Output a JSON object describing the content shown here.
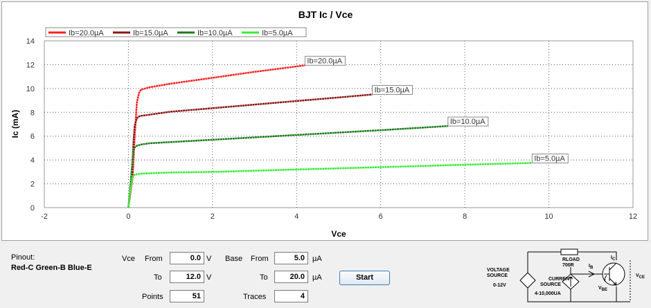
{
  "chart_data": {
    "type": "line",
    "title": "BJT Ic / Vce",
    "xlabel": "Vce",
    "ylabel": "Ic (mA)",
    "xlim": [
      -2,
      12
    ],
    "ylim": [
      0,
      14
    ],
    "xticks": [
      "-2",
      "0",
      "2",
      "4",
      "6",
      "8",
      "10",
      "12"
    ],
    "yticks": [
      "0",
      "2",
      "4",
      "6",
      "8",
      "10",
      "12",
      "14"
    ],
    "grid": true,
    "legend_position": "top-left",
    "series": [
      {
        "name": "Ib=20.0µA",
        "color": "#ff2020",
        "x": [
          0,
          0.1,
          0.15,
          0.2,
          0.25,
          0.3,
          0.5,
          1,
          2,
          3,
          4,
          4.2
        ],
        "y": [
          0,
          2.5,
          6,
          8.8,
          9.6,
          9.9,
          10.1,
          10.4,
          10.9,
          11.4,
          11.85,
          11.95
        ]
      },
      {
        "name": "Ib=15.0µA",
        "color": "#8b1414",
        "x": [
          0,
          0.08,
          0.12,
          0.15,
          0.2,
          0.25,
          0.3,
          0.5,
          1,
          2,
          3,
          4,
          5,
          5.8
        ],
        "y": [
          0,
          2.5,
          5.5,
          6.9,
          7.5,
          7.65,
          7.7,
          7.8,
          8.05,
          8.35,
          8.65,
          8.95,
          9.25,
          9.5
        ]
      },
      {
        "name": "Ib=10.0µA",
        "color": "#1a7a1a",
        "x": [
          0,
          0.06,
          0.1,
          0.12,
          0.15,
          0.2,
          0.3,
          0.5,
          1,
          2,
          4,
          6,
          7.6
        ],
        "y": [
          0,
          2.4,
          4.1,
          4.8,
          5.05,
          5.2,
          5.3,
          5.4,
          5.5,
          5.7,
          6.1,
          6.5,
          6.85
        ]
      },
      {
        "name": "Ib=5.0µA",
        "color": "#33ee33",
        "x": [
          0,
          0.05,
          0.08,
          0.1,
          0.15,
          0.2,
          0.3,
          0.6,
          1,
          2,
          4,
          6,
          8,
          9.6
        ],
        "y": [
          0,
          1.5,
          2.2,
          2.6,
          2.75,
          2.8,
          2.85,
          2.9,
          2.95,
          3.0,
          3.2,
          3.4,
          3.6,
          3.75
        ]
      }
    ]
  },
  "controls": {
    "pinout_label": "Pinout:",
    "pinout_value": "Red-C Green-B Blue-E",
    "vce_label": "Vce",
    "from_label": "From",
    "to_label": "To",
    "points_label": "Points",
    "base_label": "Base",
    "traces_label": "Traces",
    "vce_from": "0.0",
    "vce_to": "12.0",
    "points": "51",
    "base_from": "5.0",
    "base_to": "20.0",
    "traces": "4",
    "unit_v": "V",
    "unit_ua": "µA",
    "start_label": "Start"
  },
  "schematic": {
    "voltage_source_line1": "VOLTAGE",
    "voltage_source_line2": "SOURCE",
    "voltage_range": "0-12V",
    "current_source_line1": "CURRENT",
    "current_source_line2": "SOURCE",
    "current_range": "4-10,000UA",
    "rload_line1": "RLOAD",
    "rload_line2": "700R",
    "ib": "I",
    "ib_sub": "B",
    "ic": "I",
    "ic_sub": "C",
    "vbe": "V",
    "vbe_sub": "BE",
    "vce": "V",
    "vce_sub": "CE"
  }
}
